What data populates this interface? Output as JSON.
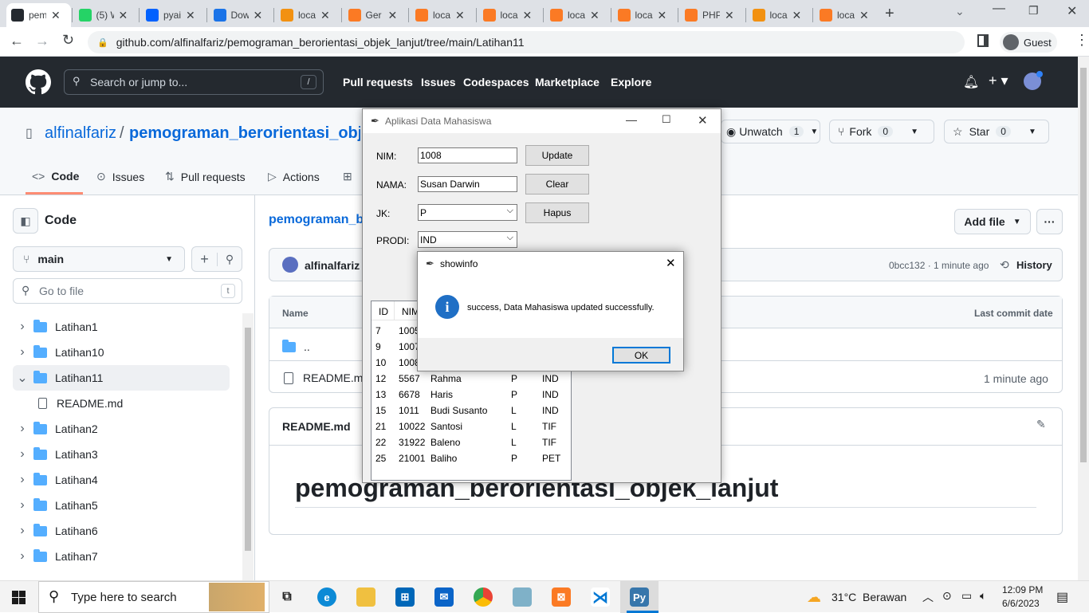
{
  "browser": {
    "tabs": [
      {
        "label": "pem",
        "favicon": "github-icon",
        "color": "#24292f"
      },
      {
        "label": "(5) W",
        "favicon": "whatsapp-icon",
        "color": "#25d366"
      },
      {
        "label": "pyai",
        "favicon": "dropbox-icon",
        "color": "#0061fe"
      },
      {
        "label": "Dow",
        "favicon": "download-icon",
        "color": "#1a73e8"
      },
      {
        "label": "loca",
        "favicon": "phpmyadmin-icon",
        "color": "#f29111"
      },
      {
        "label": "Ger",
        "favicon": "xampp-icon",
        "color": "#fb7a24"
      },
      {
        "label": "loca",
        "favicon": "xampp-icon",
        "color": "#fb7a24"
      },
      {
        "label": "loca",
        "favicon": "xampp-icon",
        "color": "#fb7a24"
      },
      {
        "label": "loca",
        "favicon": "xampp-icon",
        "color": "#fb7a24"
      },
      {
        "label": "loca",
        "favicon": "xampp-icon",
        "color": "#fb7a24"
      },
      {
        "label": "PHP",
        "favicon": "xampp-icon",
        "color": "#fb7a24"
      },
      {
        "label": "loca",
        "favicon": "phpmyadmin-icon",
        "color": "#f29111"
      },
      {
        "label": "loca",
        "favicon": "xampp-icon",
        "color": "#fb7a24"
      }
    ],
    "url": "github.com/alfinalfariz/pemograman_berorientasi_objek_lanjut/tree/main/Latihan11",
    "profile": "Guest"
  },
  "github": {
    "search_placeholder": "Search or jump to...",
    "search_key": "/",
    "nav": [
      "Pull requests",
      "Issues",
      "Codespaces",
      "Marketplace",
      "Explore"
    ],
    "owner": "alfinalfariz",
    "separator": "/",
    "repo": "pemograman_berorientasi_objek_lanjut",
    "watch_label": "Unwatch",
    "watch_count": "1",
    "fork_label": "Fork",
    "fork_count": "0",
    "star_label": "Star",
    "star_count": "0",
    "repo_tabs": [
      "Code",
      "Issues",
      "Pull requests",
      "Actions"
    ],
    "sidebar_title": "Code",
    "branch": "main",
    "goto_placeholder": "Go to file",
    "goto_key": "t",
    "tree": [
      {
        "name": "Latihan1",
        "type": "folder",
        "expanded": false
      },
      {
        "name": "Latihan10",
        "type": "folder",
        "expanded": false
      },
      {
        "name": "Latihan11",
        "type": "folder",
        "expanded": true
      },
      {
        "name": "README.md",
        "type": "file",
        "expanded": false
      },
      {
        "name": "Latihan2",
        "type": "folder",
        "expanded": false
      },
      {
        "name": "Latihan3",
        "type": "folder",
        "expanded": false
      },
      {
        "name": "Latihan4",
        "type": "folder",
        "expanded": false
      },
      {
        "name": "Latihan5",
        "type": "folder",
        "expanded": false
      },
      {
        "name": "Latihan6",
        "type": "folder",
        "expanded": false
      },
      {
        "name": "Latihan7",
        "type": "folder",
        "expanded": false
      }
    ],
    "breadcrumb": "pemograman_be",
    "add_file": "Add file",
    "more": "···",
    "commit_author": "alfinalfariz",
    "commit_meta": "0bcc132 · 1 minute ago",
    "history": "History",
    "col_name": "Name",
    "col_date": "Last commit date",
    "parent_dir": "..",
    "file_name": "README.mc",
    "file_date": "1 minute ago",
    "readme_title": "README.md",
    "readme_heading": "pemograman_berorientasi_objek_lanjut"
  },
  "app": {
    "title": "Aplikasi Data Mahasiswa",
    "nim_label": "NIM:",
    "nim_value": "1008",
    "nama_label": "NAMA:",
    "nama_value": "Susan Darwin",
    "jk_label": "JK:",
    "jk_value": "P",
    "prodi_label": "PRODI:",
    "prodi_value": "IND",
    "update_btn": "Update",
    "clear_btn": "Clear",
    "hapus_btn": "Hapus",
    "table_headers": [
      "ID",
      "NIM"
    ],
    "rows": [
      {
        "id": "7",
        "nim": "1005",
        "nama": "",
        "jk": "",
        "prodi": ""
      },
      {
        "id": "9",
        "nim": "1007",
        "nama": "",
        "jk": "",
        "prodi": ""
      },
      {
        "id": "10",
        "nim": "1008",
        "nama": "",
        "jk": "",
        "prodi": ""
      },
      {
        "id": "12",
        "nim": "5567",
        "nama": "Rahma",
        "jk": "P",
        "prodi": "IND"
      },
      {
        "id": "13",
        "nim": "6678",
        "nama": "Haris",
        "jk": "P",
        "prodi": "IND"
      },
      {
        "id": "15",
        "nim": "1011",
        "nama": "Budi Susanto",
        "jk": "L",
        "prodi": "IND"
      },
      {
        "id": "21",
        "nim": "10022",
        "nama": "Santosi",
        "jk": "L",
        "prodi": "TIF"
      },
      {
        "id": "22",
        "nim": "31922",
        "nama": "Baleno",
        "jk": "L",
        "prodi": "TIF"
      },
      {
        "id": "25",
        "nim": "21001",
        "nama": "Baliho",
        "jk": "P",
        "prodi": "PET"
      }
    ]
  },
  "dialog": {
    "title": "showinfo",
    "message": "success, Data Mahasiswa updated successfully.",
    "ok": "OK"
  },
  "taskbar": {
    "search_placeholder": "Type here to search",
    "weather": "31°C  Berawan",
    "time": "12:09 PM",
    "date": "6/6/2023"
  }
}
